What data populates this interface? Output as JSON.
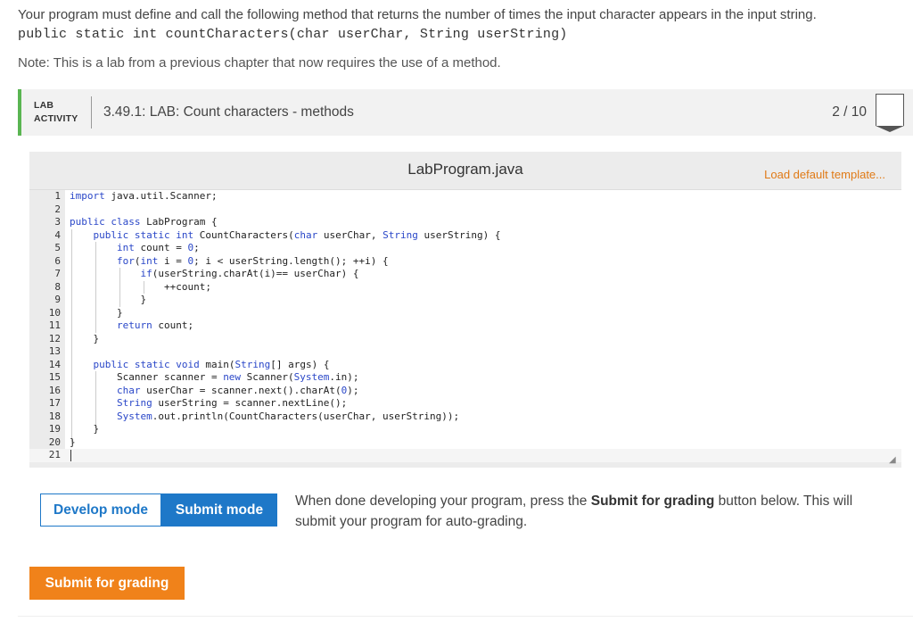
{
  "intro": {
    "text": "Your program must define and call the following method that returns the number of times the input character appears in the input string.",
    "signature": "public static int countCharacters(char userChar, String userString)",
    "note": "Note: This is a lab from a previous chapter that now requires the use of a method."
  },
  "lab": {
    "tag_line1": "LAB",
    "tag_line2": "ACTIVITY",
    "title": "3.49.1: LAB: Count characters - methods",
    "score": "2 / 10",
    "accent_color": "#5ab552"
  },
  "editor": {
    "file_name": "LabProgram.java",
    "load_template": "Load default template...",
    "line_numbers": [
      "1",
      "2",
      "3",
      "4",
      "5",
      "6",
      "7",
      "8",
      "9",
      "10",
      "11",
      "12",
      "13",
      "14",
      "15",
      "16",
      "17",
      "18",
      "19",
      "20",
      "21"
    ]
  },
  "modes": {
    "develop_label": "Develop mode",
    "submit_label": "Submit mode"
  },
  "help": {
    "before": "When done developing your program, press the ",
    "bold": "Submit for grading",
    "after": " button below. This will submit your program for auto-grading."
  },
  "submit_button": "Submit for grading",
  "colors": {
    "primary": "#1e78c8",
    "orange": "#f0821a"
  }
}
